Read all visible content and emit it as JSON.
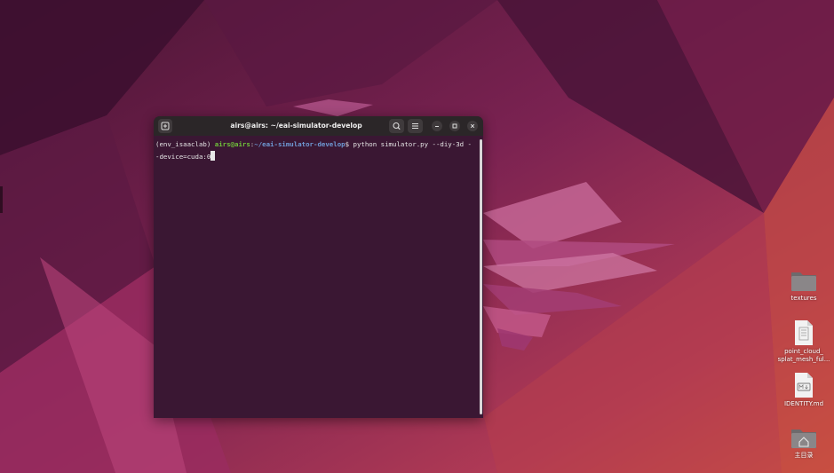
{
  "colors": {
    "terminal_bg": "#3a1733",
    "titlebar_bg": "#2b2628",
    "prompt_user": "#6fc13a",
    "prompt_path": "#6f9bd6",
    "text": "#e6e6e6"
  },
  "terminal": {
    "title": "airs@airs: ~/eai-simulator-develop",
    "icons": {
      "new_tab": "new-tab-icon",
      "search": "search-icon",
      "menu": "hamburger-menu-icon",
      "minimize": "minimize-icon",
      "maximize": "maximize-icon",
      "close": "close-icon"
    },
    "prompt_env": "(env_isaaclab) ",
    "prompt_user": "airs@airs",
    "prompt_sep": ":",
    "prompt_path": "~/eai-simulator-develop",
    "prompt_symbol": "$ ",
    "command_line1": "python simulator.py --diy-3d -",
    "command_line2": "-device=cuda:0"
  },
  "desktop_items": [
    {
      "label": "textures",
      "icon": "folder-icon"
    },
    {
      "label_line1": "point_cloud_",
      "label_line2": "splat_mesh_ful...",
      "icon": "binary-file-icon"
    },
    {
      "label": "IDENTITY.md",
      "icon": "markdown-file-icon"
    },
    {
      "label": "主目录",
      "icon": "home-folder-icon"
    }
  ]
}
